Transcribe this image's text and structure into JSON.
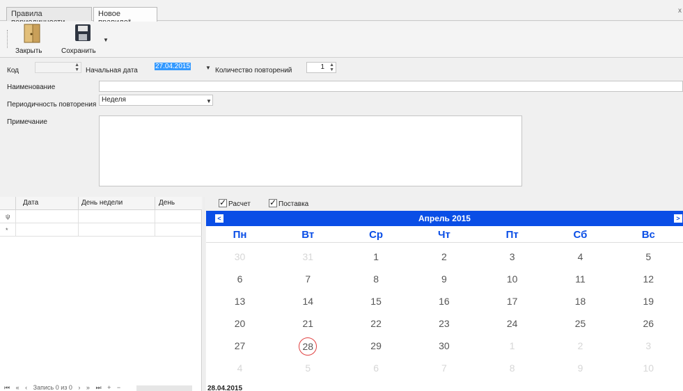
{
  "tabs": [
    {
      "label": "Правила периодичности"
    },
    {
      "label": "Новое правило*"
    }
  ],
  "tab_close": "x",
  "toolbar": {
    "close_label": "Закрыть",
    "save_label": "Сохранить"
  },
  "form": {
    "code_label": "Код",
    "code_value": "",
    "start_date_label": "Начальная дата",
    "start_date_value": "27.04.2015",
    "repeat_count_label": "Количество повторений",
    "repeat_count_value": "1",
    "name_label": "Наименование",
    "name_value": "",
    "periodicity_label": "Периодичность повторения",
    "periodicity_value": "Неделя",
    "note_label": "Примечание",
    "note_value": ""
  },
  "grid": {
    "columns": [
      "Дата",
      "День недели",
      "День"
    ],
    "filter_row_marker": "ψ",
    "new_row_marker": "*",
    "navigator_text": "Запись 0 из 0"
  },
  "checkboxes": [
    {
      "label": "Расчет",
      "checked": true
    },
    {
      "label": "Поставка",
      "checked": true
    }
  ],
  "calendar": {
    "title": "Апрель 2015",
    "prev": "<",
    "next": ">",
    "weekdays": [
      "Пн",
      "Вт",
      "Ср",
      "Чт",
      "Пт",
      "Сб",
      "Вс"
    ],
    "weeks": [
      [
        "30",
        "31",
        "1",
        "2",
        "3",
        "4",
        "5"
      ],
      [
        "6",
        "7",
        "8",
        "9",
        "10",
        "11",
        "12"
      ],
      [
        "13",
        "14",
        "15",
        "16",
        "17",
        "18",
        "19"
      ],
      [
        "20",
        "21",
        "22",
        "23",
        "24",
        "25",
        "26"
      ],
      [
        "27",
        "28",
        "29",
        "30",
        "1",
        "2",
        "3"
      ],
      [
        "4",
        "5",
        "6",
        "7",
        "8",
        "9",
        "10"
      ]
    ],
    "today_marker": "28",
    "selected_date": "28.04.2015",
    "colors": {
      "header": "#0a4ee6",
      "today_ring": "#e04040"
    }
  }
}
